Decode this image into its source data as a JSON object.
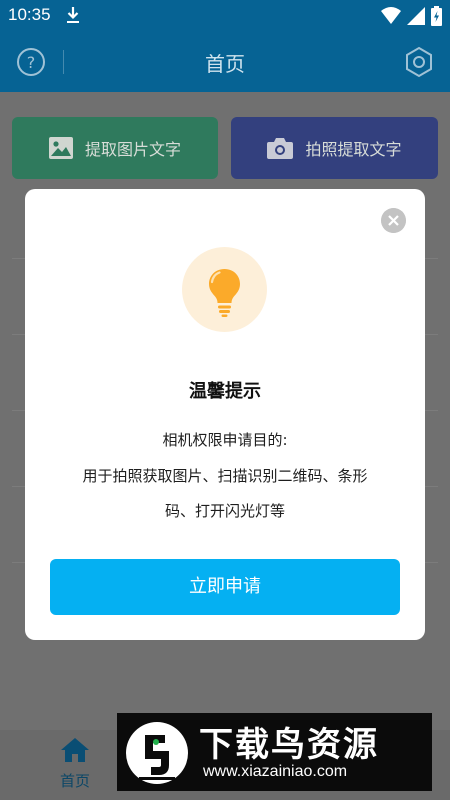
{
  "status_bar": {
    "time": "10:35",
    "icons": [
      "download-icon",
      "wifi-icon",
      "signal-icon",
      "battery-icon"
    ]
  },
  "app_bar": {
    "title": "首页",
    "left_icon": "help-icon",
    "right_icon": "settings-icon"
  },
  "actions": {
    "extract_image_text": "提取图片文字",
    "photo_extract_text": "拍照提取文字"
  },
  "dialog": {
    "title": "温馨提示",
    "line1": "相机权限申请目的:",
    "line2": "用于拍照获取图片、扫描识别二维码、条形",
    "line3": "码、打开闪光灯等",
    "button": "立即申请",
    "icon": "lightbulb-icon"
  },
  "bottom_nav": {
    "home_label": "首页"
  },
  "watermark": {
    "title": "下载鸟资源",
    "url": "www.xiazainiao.com"
  },
  "colors": {
    "primary": "#066394",
    "accent_button": "#05b0f2",
    "bulb": "#fbaa2a"
  }
}
